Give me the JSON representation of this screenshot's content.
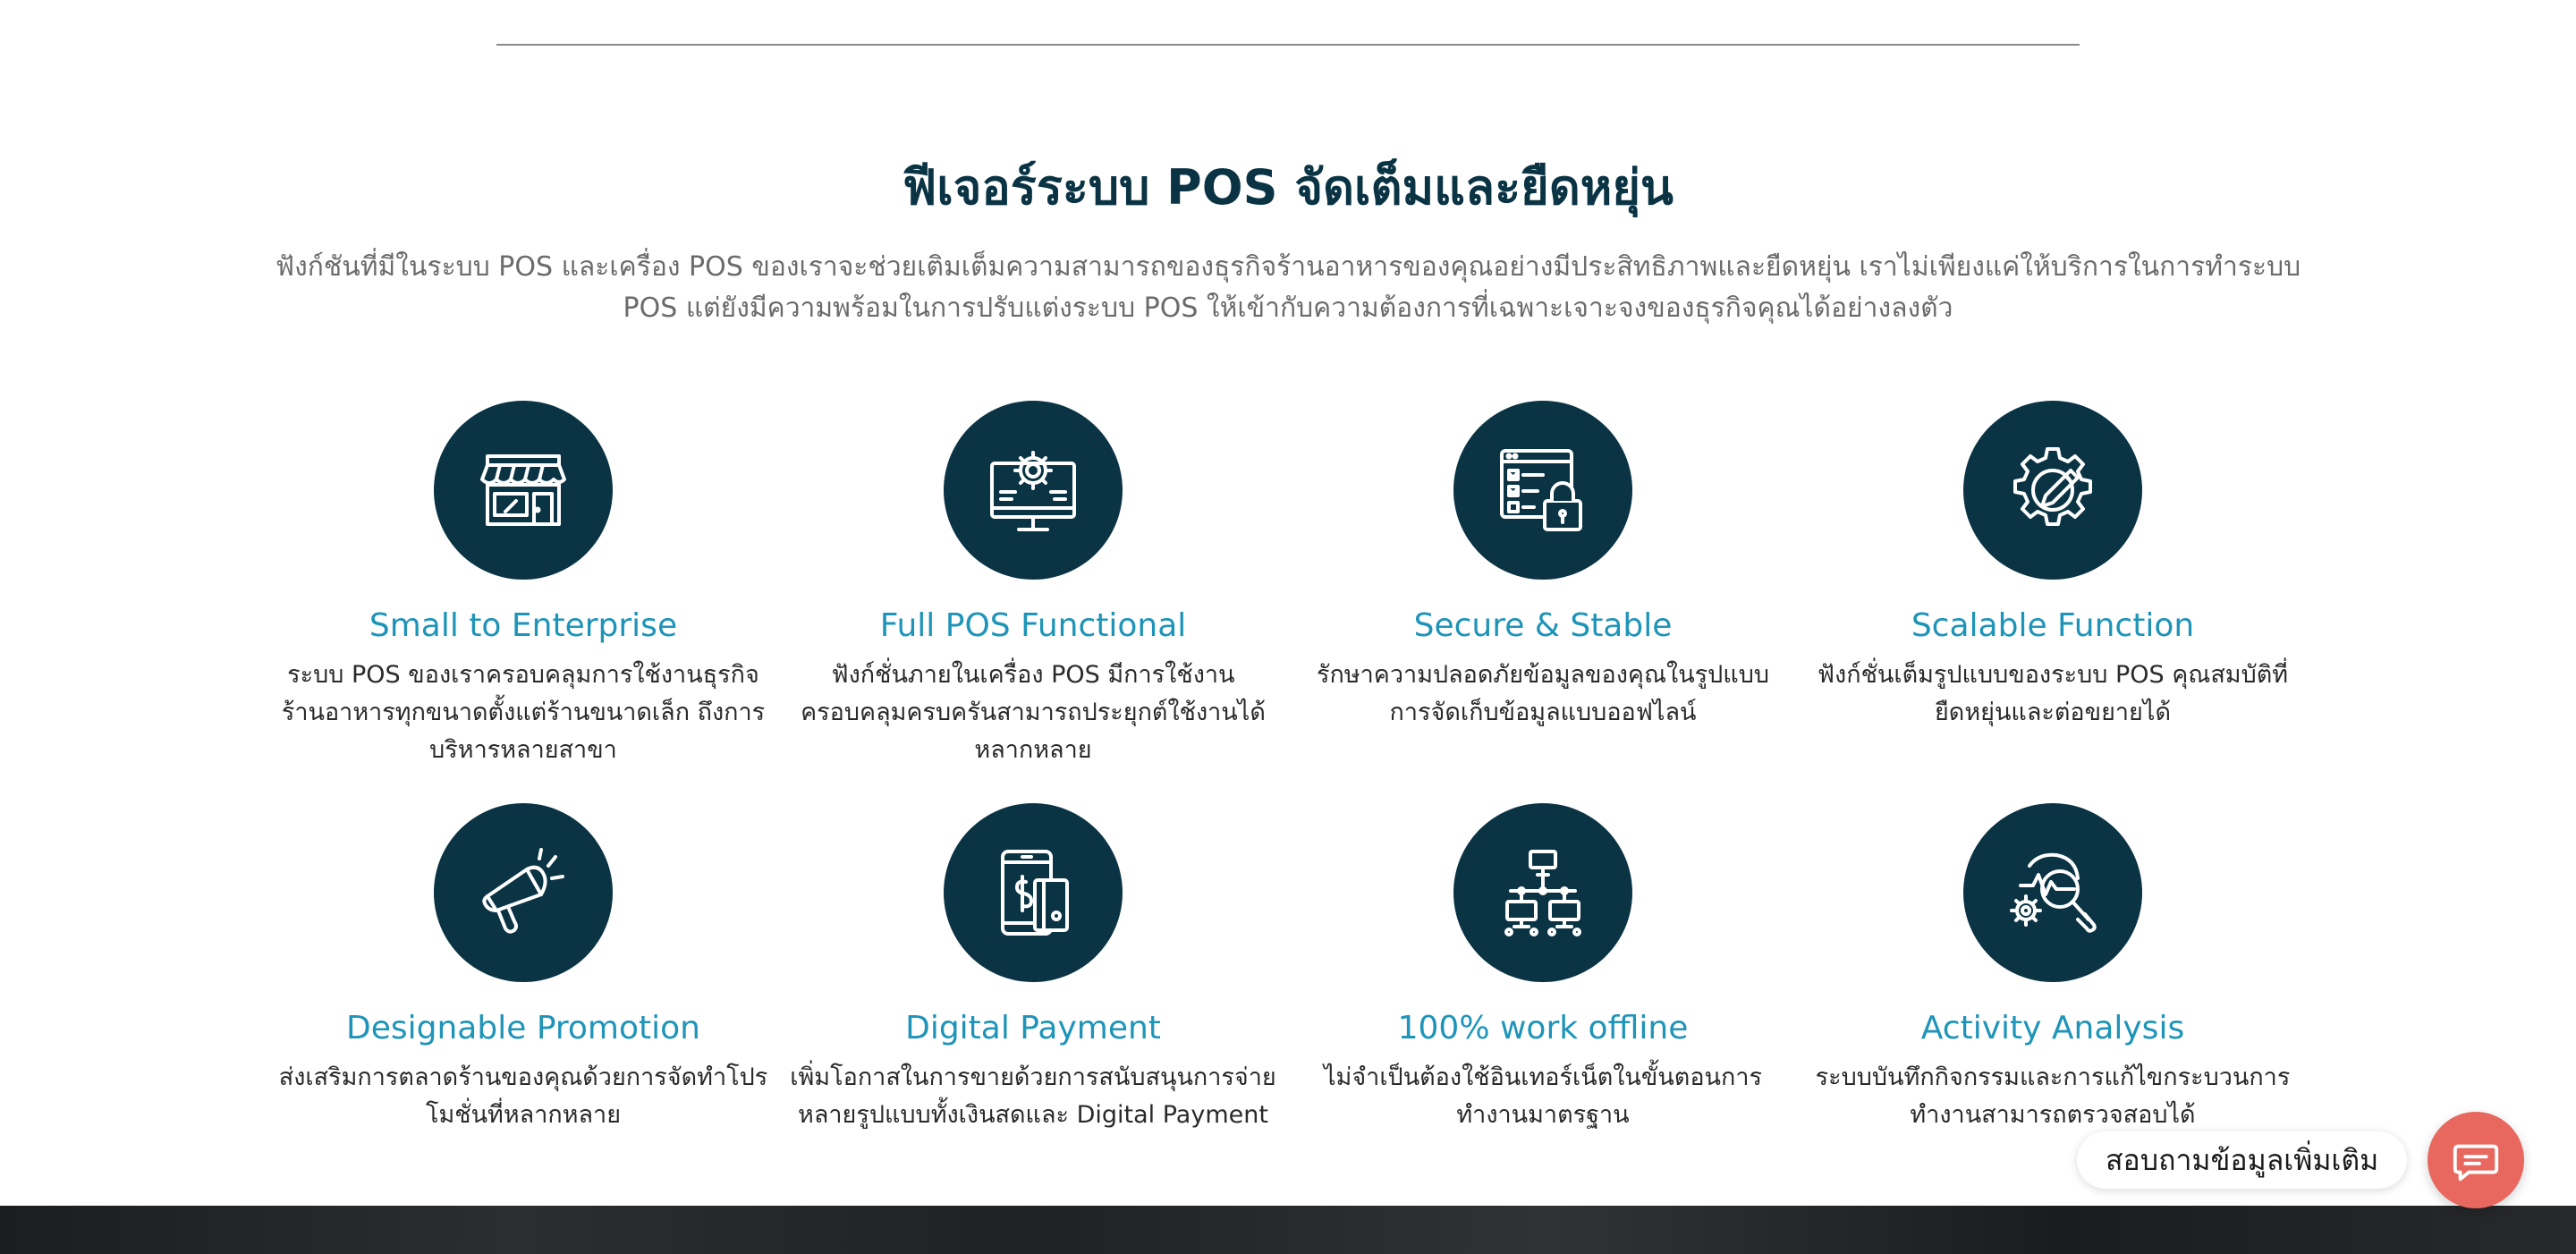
{
  "section": {
    "title": "ฟีเจอร์ระบบ POS จัดเต็มและยืดหยุ่น",
    "description": "ฟังก์ชันที่มีในระบบ POS และเครื่อง POS ของเราจะช่วยเติมเต็มความสามารถของธุรกิจร้านอาหารของคุณอย่างมีประสิทธิภาพและยืดหยุ่น เราไม่เพียงแค่ให้บริการในการทำระบบ POS แต่ยังมีความพร้อมในการปรับแต่งระบบ POS ให้เข้ากับความต้องการที่เฉพาะเจาะจงของธุรกิจคุณได้อย่างลงตัว"
  },
  "features": [
    {
      "icon": "storefront-icon",
      "title": "Small to Enterprise",
      "description": "ระบบ POS ของเราครอบคลุมการใช้งานธุรกิจร้านอาหารทุกขนาดตั้งแต่ร้านขนาดเล็ก ถึงการบริหารหลายสาขา"
    },
    {
      "icon": "monitor-gear-icon",
      "title": "Full POS Functional",
      "description": "ฟังก์ชั่นภายในเครื่อง POS มีการใช้งานครอบคลุมครบครันสามารถประยุกต์ใช้งานได้หลากหลาย"
    },
    {
      "icon": "secure-lock-icon",
      "title": "Secure & Stable",
      "description": "รักษาความปลอดภัยข้อมูลของคุณในรูปแบบการจัดเก็บข้อมูลแบบออฟไลน์"
    },
    {
      "icon": "gear-pencil-icon",
      "title": "Scalable Function",
      "description": "ฟังก์ชั่นเต็มรูปแบบของระบบ POS คุณสมบัติที่ยืดหยุ่นและต่อขยายได้"
    },
    {
      "icon": "megaphone-icon",
      "title": "Designable Promotion",
      "description": "ส่งเสริมการตลาดร้านของคุณด้วยการจัดทำโปรโมชั่นที่หลากหลาย"
    },
    {
      "icon": "mobile-payment-icon",
      "title": "Digital Payment",
      "description": "เพิ่มโอกาสในการขายด้วยการสนับสนุนการจ่ายหลายรูปแบบทั้งเงินสดและ Digital Payment"
    },
    {
      "icon": "network-offline-icon",
      "title": "100% work offline",
      "description": "ไม่จำเป็นต้องใช้อินเทอร์เน็ตในขั้นตอนการทำงานมาตรฐาน"
    },
    {
      "icon": "activity-analysis-icon",
      "title": "Activity Analysis",
      "description": "ระบบบันทึกกิจกรรมและการแก้ไขกระบวนการทำงานสามารถตรวจสอบได้"
    }
  ],
  "chat_widget": {
    "label": "สอบถามข้อมูลเพิ่มเติม",
    "icon": "chat-bubble-icon"
  },
  "colors": {
    "primary_dark": "#0a3344",
    "accent_blue": "#1e94b9",
    "chat_button": "#e8685f"
  }
}
